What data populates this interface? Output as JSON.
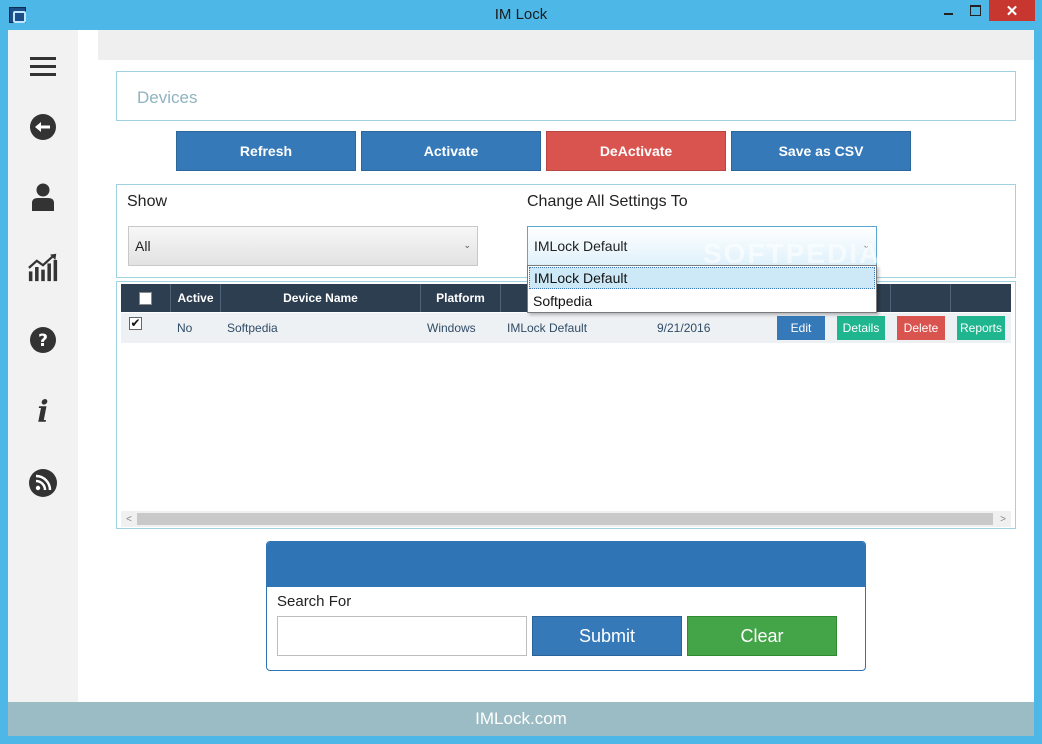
{
  "window": {
    "title": "IM Lock",
    "close_glyph": "✕",
    "accent": "#4db8e8"
  },
  "sidebar": {
    "icons": [
      "menu-icon",
      "back-arrow-icon",
      "user-icon",
      "stats-chart-icon",
      "help-icon",
      "info-icon",
      "rss-icon"
    ]
  },
  "devices": {
    "title": "Devices"
  },
  "toolbar": {
    "refresh_label": "Refresh",
    "activate_label": "Activate",
    "deactivate_label": "DeActivate",
    "save_csv_label": "Save as CSV"
  },
  "filters": {
    "show_label": "Show",
    "show_value": "All",
    "change_label": "Change All Settings To",
    "change_value": "IMLock Default",
    "change_options": [
      "IMLock Default",
      "Softpedia"
    ]
  },
  "table": {
    "headers": {
      "active": "Active",
      "device_name": "Device Name",
      "platform": "Platform"
    },
    "rows": [
      {
        "checked": "✔",
        "active": "No",
        "device_name": "Softpedia",
        "platform": "Windows",
        "setting": "IMLock Default",
        "date": "9/21/2016",
        "edit_label": "Edit",
        "details_label": "Details",
        "delete_label": "Delete",
        "reports_label": "Reports"
      }
    ],
    "scroll_left": "<",
    "scroll_right": ">"
  },
  "search": {
    "label": "Search For",
    "value": "",
    "submit_label": "Submit",
    "clear_label": "Clear"
  },
  "watermark": "SOFTPEDIA",
  "footer": {
    "text": "IMLock.com"
  },
  "colors": {
    "primary_blue": "#3579b8",
    "danger_red": "#d9534f",
    "success_green": "#43a547",
    "teal": "#1fb58f",
    "table_header": "#2d3e50",
    "footer": "#9bbcc4"
  }
}
